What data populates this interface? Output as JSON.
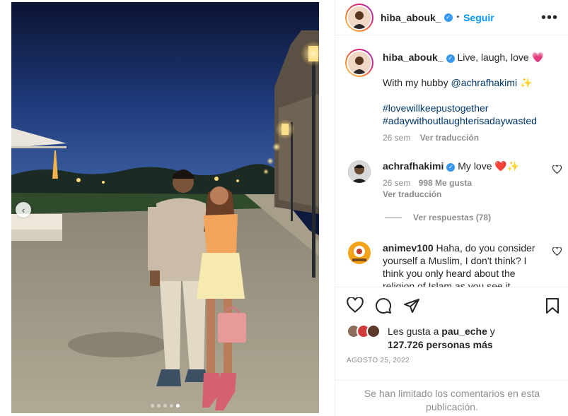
{
  "post": {
    "carousel": {
      "slide_count": 5,
      "active_slide": 5
    }
  },
  "header": {
    "username": "hiba_abouk_",
    "separator": "•",
    "follow_label": "Seguir",
    "more_label": "•••"
  },
  "caption": {
    "username": "hiba_abouk_",
    "line1": "Live, laugh, love 💗",
    "line2_text": "With my hubby",
    "line2_mention": "@achrafhakimi",
    "line2_tail": "✨",
    "hashtag1": "#lovewillkeepustogether",
    "hashtag2": "#adaywithoutlaughterisadaywasted",
    "age": "26 sem",
    "translate": "Ver traducción"
  },
  "comments": [
    {
      "username": "achrafhakimi",
      "text": "My love ❤️✨",
      "age": "26 sem",
      "likes": "998 Me gusta",
      "translate": "Ver traducción",
      "replies_label": "Ver respuestas (78)"
    },
    {
      "username": "animev100",
      "text": "Haha, do you consider yourself a Muslim, I don't think? I think you only heard about the religion of Islam as you see it"
    }
  ],
  "likes": {
    "prefix": "Les gusta a",
    "user": "pau_eche",
    "joiner": "y",
    "count": "127.726 personas más"
  },
  "date": "AGOSTO 25, 2022",
  "limited_notice": "Se han limitado los comentarios en esta publicación.",
  "colors": {
    "accent": "#0095f6",
    "verified": "#3897f0",
    "muted": "#8e8e8e",
    "heart": "#e0245e",
    "sky": "#0f1b3e"
  },
  "icons": [
    "chevron-left-icon",
    "verified-badge-icon",
    "more-icon",
    "heart-icon",
    "comment-icon",
    "share-icon",
    "bookmark-icon"
  ]
}
